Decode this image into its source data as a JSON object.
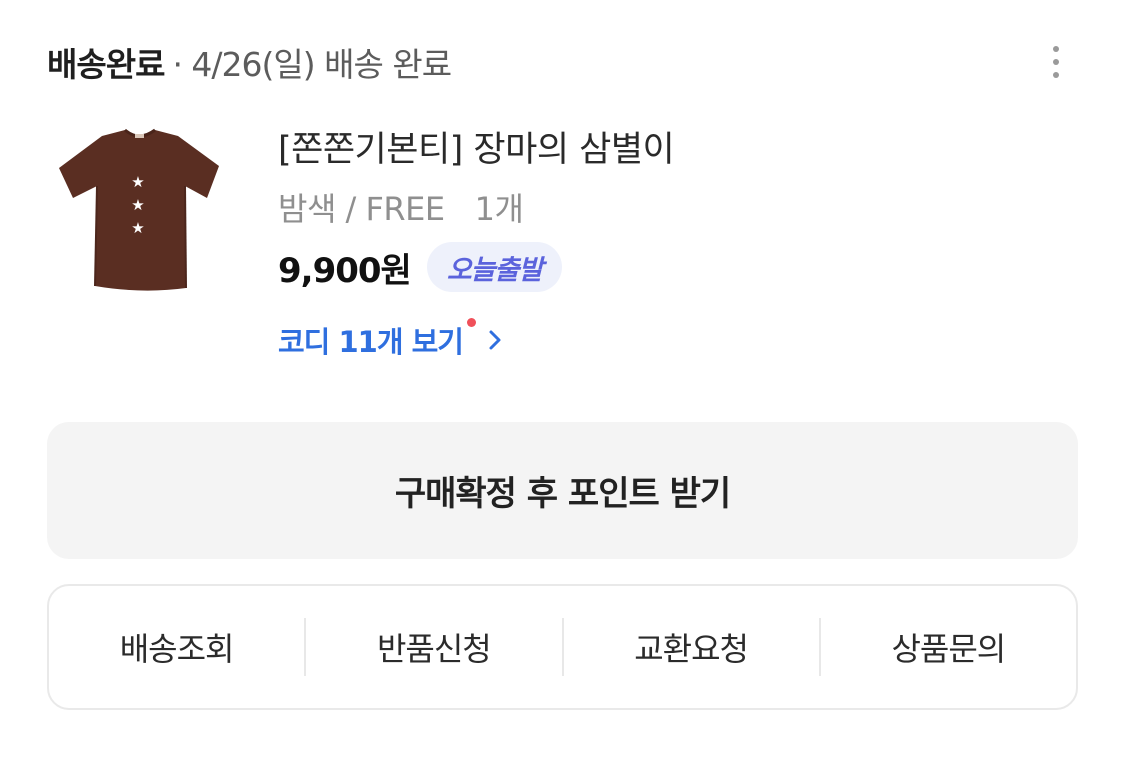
{
  "order": {
    "status_title": "배송완료",
    "status_detail": "· 4/26(일) 배송 완료",
    "more_icon": "more-vertical-icon"
  },
  "product": {
    "image_icon": "tshirt-thumbnail",
    "image_color": "#5a2e22",
    "name": "[쫀쫀기본티] 장마의 삼별이",
    "option": "밤색 / FREE",
    "quantity": "1개",
    "price": "9,900원",
    "badge": "오늘출발",
    "codi_link": "코디 11개 보기",
    "codi_link_icon": "chevron-right-icon"
  },
  "confirm_button": "구매확정 후 포인트 받기",
  "actions": [
    {
      "label": "배송조회"
    },
    {
      "label": "반품신청"
    },
    {
      "label": "교환요청"
    },
    {
      "label": "상품문의"
    }
  ],
  "colors": {
    "link": "#2f6fdf",
    "badge_text": "#5b63dc",
    "badge_bg": "#eef1fb",
    "new_dot": "#f0505a"
  }
}
